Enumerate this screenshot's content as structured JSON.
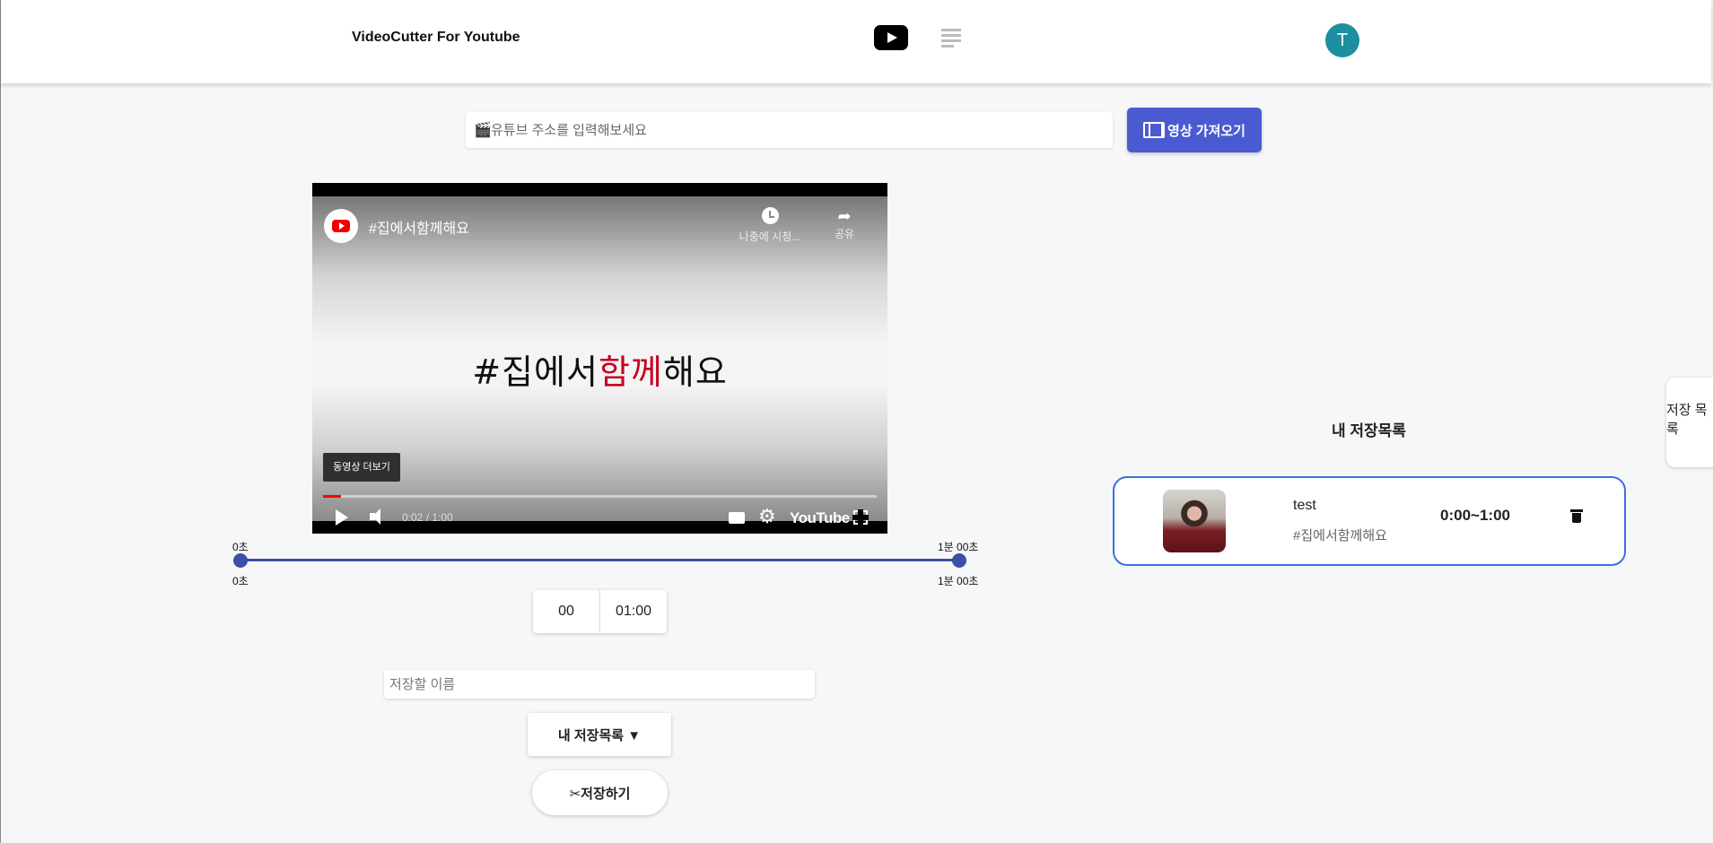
{
  "header": {
    "app_title": "VideoCutter For Youtube",
    "avatar_initial": "T",
    "avatar_color": "#1c8fa0"
  },
  "url_bar": {
    "placeholder": "유튜브 주소를 입력해보세요",
    "value": "",
    "fetch_label": "영상 가져오기",
    "accent": "#4a5bd1"
  },
  "player": {
    "title": "#집에서함께해요",
    "watch_later": "나중에 시청...",
    "share": "공유",
    "screen_text_a": "#집에서",
    "screen_text_red": "함께",
    "screen_text_b": "해요",
    "more_videos": "동영상 더보기",
    "time": "0:02 / 1:00",
    "progress_fraction": 0.033,
    "logo": "YouTube"
  },
  "range": {
    "start_top": "0초",
    "end_top": "1분 00초",
    "start_bottom": "0초",
    "end_bottom": "1분 00초",
    "start_fraction": 0,
    "end_fraction": 1
  },
  "times": {
    "start": "00",
    "end": "01:00"
  },
  "save_name": {
    "placeholder": "저장할 이름",
    "value": ""
  },
  "buttons": {
    "my_list": "내 저장목록 ▼",
    "save": "✂저장하기"
  },
  "saved": {
    "title": "내 저장목록",
    "items": [
      {
        "name": "test",
        "video": "#집에서함께해요",
        "range": "0:00~1:00"
      }
    ]
  },
  "side_tab": {
    "label_line1": "저장 목",
    "label_line2": "록"
  }
}
